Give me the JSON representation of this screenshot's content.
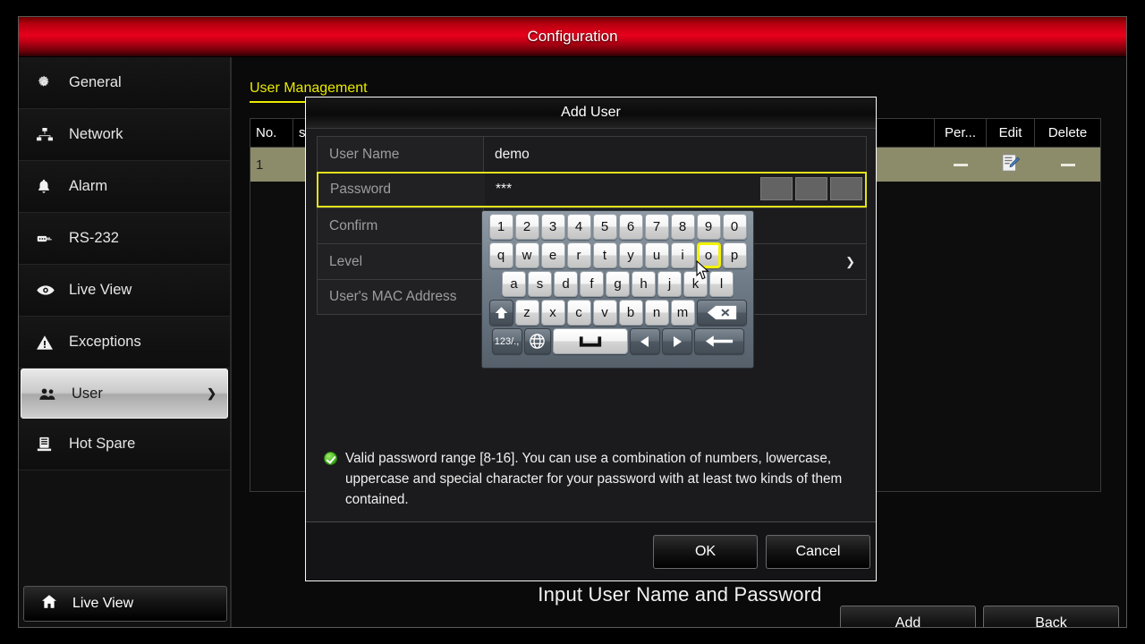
{
  "window": {
    "title": "Configuration"
  },
  "sidebar": {
    "items": [
      {
        "label": "General",
        "icon": "gear-icon",
        "active": false
      },
      {
        "label": "Network",
        "icon": "network-icon",
        "active": false
      },
      {
        "label": "Alarm",
        "icon": "bell-icon",
        "active": false
      },
      {
        "label": "RS-232",
        "icon": "serial-port-icon",
        "active": false
      },
      {
        "label": "Live View",
        "icon": "eye-icon",
        "active": false
      },
      {
        "label": "Exceptions",
        "icon": "warning-icon",
        "active": false
      },
      {
        "label": "User",
        "icon": "users-icon",
        "active": true
      },
      {
        "label": "Hot Spare",
        "icon": "server-icon",
        "active": false
      }
    ],
    "live_view_button": {
      "label": "Live View",
      "icon": "home-icon"
    }
  },
  "main": {
    "tab": "User Management",
    "table": {
      "columns": [
        "No.",
        "s",
        "Per...",
        "Edit",
        "Delete"
      ],
      "rows": [
        {
          "no": "1",
          "name": "",
          "permission": "—",
          "edit": "edit-icon",
          "delete": "—"
        }
      ]
    },
    "caption": "Input User Name and Password",
    "buttons": {
      "add": "Add",
      "back": "Back"
    }
  },
  "modal": {
    "title": "Add User",
    "fields": [
      {
        "label": "User Name",
        "value": "demo",
        "focused": false,
        "type": "text"
      },
      {
        "label": "Password",
        "value": "***",
        "focused": true,
        "type": "password",
        "strength_blocks": 3
      },
      {
        "label": "Confirm",
        "value": "",
        "focused": false,
        "type": "password"
      },
      {
        "label": "Level",
        "value": "",
        "focused": false,
        "type": "select"
      },
      {
        "label": "User's MAC Address",
        "value": "",
        "focused": false,
        "type": "text"
      }
    ],
    "hint": "Valid password range [8-16]. You can use a combination of numbers, lowercase, uppercase and special character for your password with at least two kinds of them contained.",
    "buttons": {
      "ok": "OK",
      "cancel": "Cancel"
    }
  },
  "keyboard": {
    "rows": [
      {
        "id": "kb-r1",
        "keys": [
          {
            "label": "1"
          },
          {
            "label": "2"
          },
          {
            "label": "3"
          },
          {
            "label": "4"
          },
          {
            "label": "5"
          },
          {
            "label": "6"
          },
          {
            "label": "7"
          },
          {
            "label": "8"
          },
          {
            "label": "9"
          },
          {
            "label": "0"
          }
        ]
      },
      {
        "id": "kb-r2",
        "keys": [
          {
            "label": "q"
          },
          {
            "label": "w"
          },
          {
            "label": "e"
          },
          {
            "label": "r"
          },
          {
            "label": "t"
          },
          {
            "label": "y"
          },
          {
            "label": "u"
          },
          {
            "label": "i"
          },
          {
            "label": "o",
            "highlighted": true
          },
          {
            "label": "p"
          }
        ]
      },
      {
        "id": "kb-r3",
        "keys": [
          {
            "label": "a"
          },
          {
            "label": "s"
          },
          {
            "label": "d"
          },
          {
            "label": "f"
          },
          {
            "label": "g"
          },
          {
            "label": "h"
          },
          {
            "label": "j"
          },
          {
            "label": "k"
          },
          {
            "label": "l"
          }
        ]
      },
      {
        "id": "kb-r4",
        "keys": [
          {
            "label": "",
            "icon": "shift-icon",
            "dark": true,
            "wide": true
          },
          {
            "label": "z"
          },
          {
            "label": "x"
          },
          {
            "label": "c"
          },
          {
            "label": "v"
          },
          {
            "label": "b"
          },
          {
            "label": "n"
          },
          {
            "label": "m"
          },
          {
            "label": "",
            "icon": "backspace-icon",
            "dark": true,
            "wide": true
          }
        ]
      },
      {
        "id": "kb-r5",
        "keys": [
          {
            "label": "123/.,",
            "icon": "symbols-icon",
            "dark": true
          },
          {
            "label": "",
            "icon": "globe-icon",
            "dark": true
          },
          {
            "label": "",
            "icon": "space-icon",
            "space": true
          },
          {
            "label": "",
            "icon": "arrow-left-icon",
            "dark": true
          },
          {
            "label": "",
            "icon": "arrow-right-icon",
            "dark": true
          },
          {
            "label": "",
            "icon": "enter-icon",
            "dark": true,
            "wide": true
          }
        ]
      }
    ]
  },
  "colors": {
    "titlebar_red": "#e8001c",
    "tab_yellow": "#eaea00",
    "focus_yellow": "#e2e21c",
    "key_highlight": "#f2f200",
    "row_olive": "#8c8c6b",
    "hint_green": "#49b81e"
  }
}
